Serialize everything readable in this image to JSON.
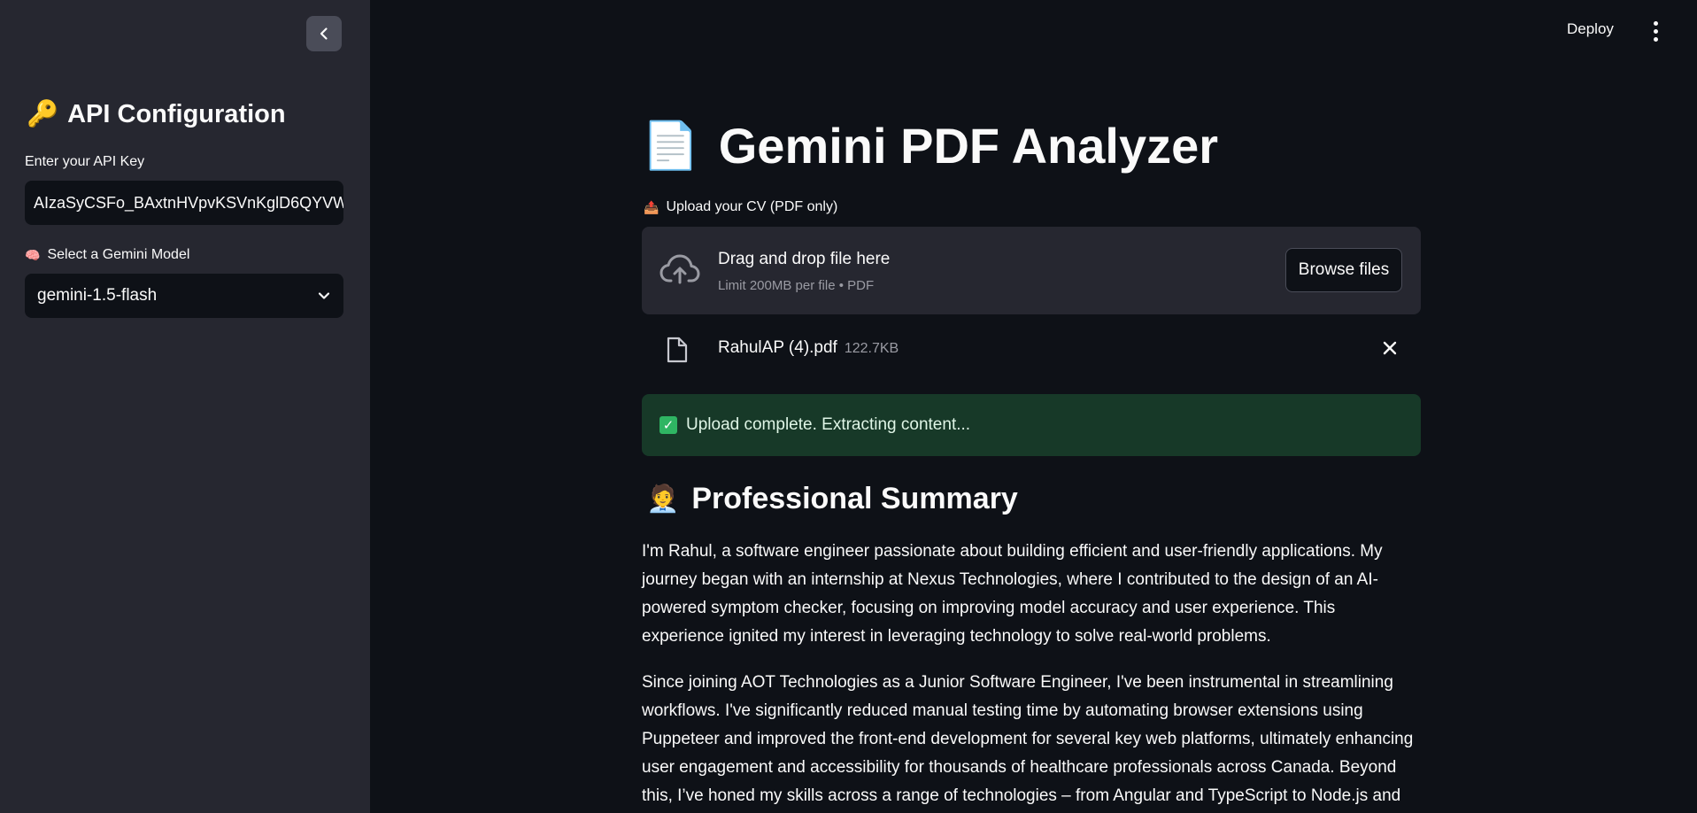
{
  "sidebar": {
    "title_icon": "🔑",
    "title": "API Configuration",
    "api_key_label": "Enter your API Key",
    "api_key_value": "AIzaSyCSFo_BAxtnHVpvKSVnKglD6QYVW",
    "model_label_icon": "🧠",
    "model_label": "Select a Gemini Model",
    "model_selected": "gemini-1.5-flash"
  },
  "header": {
    "deploy_label": "Deploy"
  },
  "main": {
    "title_icon": "📄",
    "title": "Gemini PDF Analyzer",
    "upload_label_icon": "📤",
    "upload_label": "Upload your CV (PDF only)",
    "dropzone_title": "Drag and drop file here",
    "dropzone_subtitle": "Limit 200MB per file • PDF",
    "browse_label": "Browse files",
    "file_name": "RahulAP (4).pdf",
    "file_size": "122.7KB",
    "alert_text": "Upload complete. Extracting content...",
    "section_icon": "🧑‍💼",
    "section_title": "Professional Summary",
    "paragraphs": [
      "I'm Rahul, a software engineer passionate about building efficient and user-friendly applications. My journey began with an internship at Nexus Technologies, where I contributed to the design of an AI-powered symptom checker, focusing on improving model accuracy and user experience. This experience ignited my interest in leveraging technology to solve real-world problems.",
      "Since joining AOT Technologies as a Junior Software Engineer, I've been instrumental in streamlining workflows. I've significantly reduced manual testing time by automating browser extensions using Puppeteer and improved the front-end development for several key web platforms, ultimately enhancing user engagement and accessibility for thousands of healthcare professionals across Canada. Beyond this, I’ve honed my skills across a range of technologies – from Angular and TypeScript to Node.js and various"
    ]
  },
  "colors": {
    "sidebar_bg": "#262730",
    "main_bg": "#0e1117",
    "success_bg": "#173928",
    "success_icon": "#2fb563"
  },
  "icons": [
    "chevron-left-icon",
    "cloud-upload-icon",
    "file-icon",
    "close-icon",
    "chevron-down-icon",
    "vertical-dots-icon"
  ]
}
